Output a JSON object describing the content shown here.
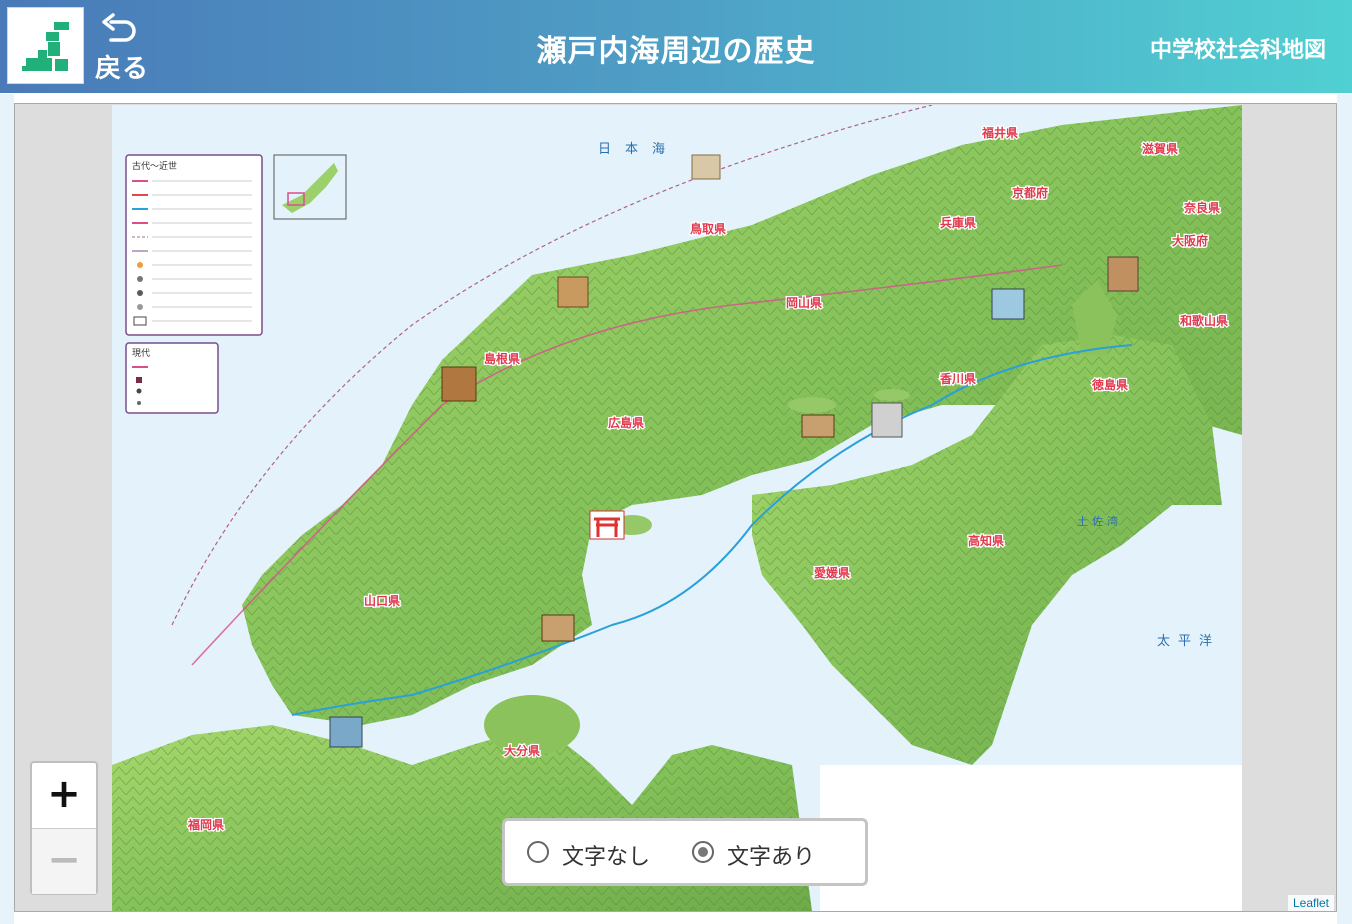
{
  "header": {
    "back_label": "戻る",
    "title": "瀬戸内海周辺の歴史",
    "subtitle": "中学校社会科地図"
  },
  "icons": {
    "logo": "japan-map-logo-icon",
    "back": "return-arrow-icon"
  },
  "colors": {
    "header_left": "#4a7ab8",
    "header_right": "#50d0d2",
    "sea": "#e3f2fb",
    "land": "#8ccc5a",
    "prefecture_label": "#e03a4e",
    "route": "#2aa0d8"
  },
  "map": {
    "sea_labels": [
      "日本海",
      "太平洋",
      "土佐湾"
    ],
    "prefecture_labels": [
      "福井県",
      "京都府",
      "滋賀県",
      "奈良県",
      "大阪府",
      "和歌山県",
      "兵庫県",
      "鳥取県",
      "岡山県",
      "島根県",
      "広島県",
      "山口県",
      "香川県",
      "徳島県",
      "愛媛県",
      "高知県",
      "大分県",
      "福岡県"
    ],
    "legend_title": "古代～近世",
    "legend_modern_title": "現代"
  },
  "zoom": {
    "in_label": "+",
    "out_label": "−"
  },
  "label_toggle": {
    "options": [
      {
        "label": "文字なし",
        "selected": false
      },
      {
        "label": "文字あり",
        "selected": true
      }
    ]
  },
  "attribution": "Leaflet"
}
